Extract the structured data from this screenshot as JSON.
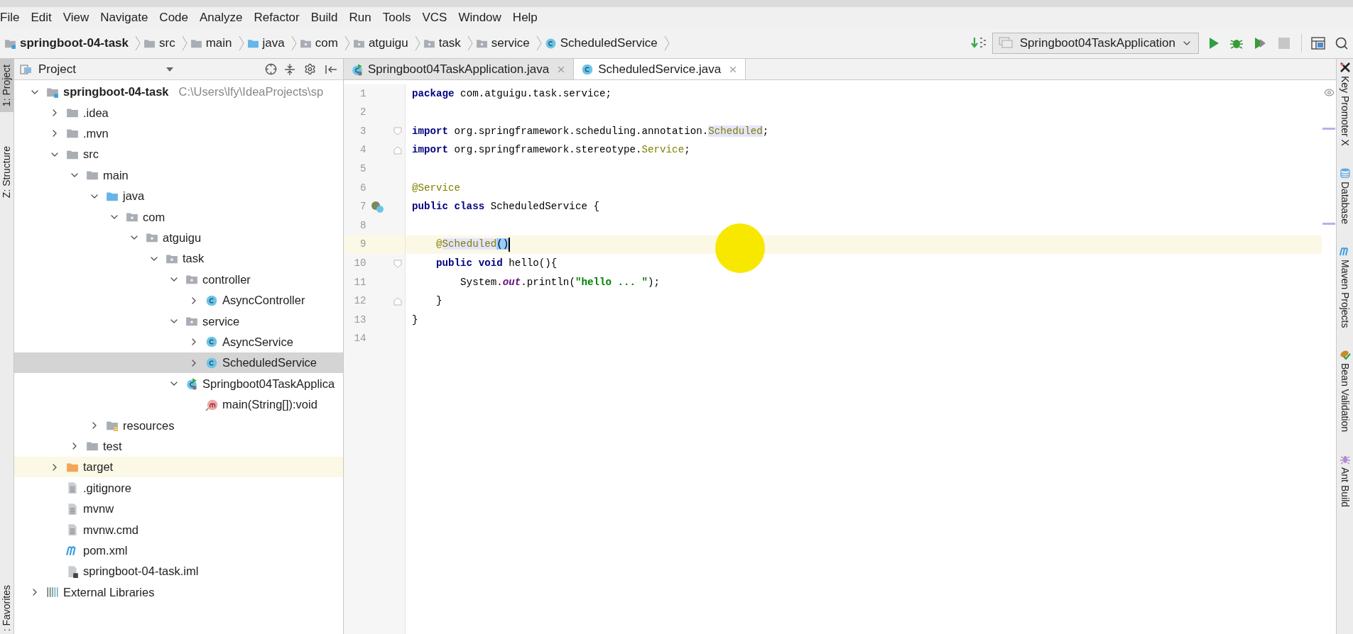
{
  "menu": [
    "File",
    "Edit",
    "View",
    "Navigate",
    "Code",
    "Analyze",
    "Refactor",
    "Build",
    "Run",
    "Tools",
    "VCS",
    "Window",
    "Help"
  ],
  "breadcrumb": [
    {
      "kind": "module",
      "text": "springboot-04-task"
    },
    {
      "kind": "folder",
      "text": "src"
    },
    {
      "kind": "folder",
      "text": "main"
    },
    {
      "kind": "source-folder",
      "text": "java"
    },
    {
      "kind": "package",
      "text": "com"
    },
    {
      "kind": "package",
      "text": "atguigu"
    },
    {
      "kind": "package",
      "text": "task"
    },
    {
      "kind": "package",
      "text": "service"
    },
    {
      "kind": "class",
      "text": "ScheduledService"
    }
  ],
  "run_config": "Springboot04TaskApplication",
  "left_strip": {
    "top": [
      {
        "label": "1: Project",
        "selected": true
      },
      {
        "label": "Z: Structure",
        "selected": false
      }
    ],
    "bottom": [
      {
        "label": ": Favorites",
        "selected": false
      }
    ]
  },
  "project_panel": {
    "title": "Project",
    "tree": [
      {
        "kind": "module",
        "label": "springboot-04-task",
        "path": "C:\\Users\\lfy\\IdeaProjects\\sp",
        "expanded": true,
        "selected": false,
        "children": [
          {
            "kind": "folder",
            "label": ".idea",
            "expanded": false,
            "selected": false
          },
          {
            "kind": "folder",
            "label": ".mvn",
            "expanded": false,
            "selected": false
          },
          {
            "kind": "folder",
            "label": "src",
            "expanded": true,
            "selected": false,
            "children": [
              {
                "kind": "folder",
                "label": "main",
                "expanded": true,
                "selected": false,
                "children": [
                  {
                    "kind": "source-folder",
                    "label": "java",
                    "expanded": true,
                    "selected": false,
                    "children": [
                      {
                        "kind": "package",
                        "label": "com",
                        "expanded": true,
                        "selected": false,
                        "children": [
                          {
                            "kind": "package",
                            "label": "atguigu",
                            "expanded": true,
                            "selected": false,
                            "children": [
                              {
                                "kind": "package",
                                "label": "task",
                                "expanded": true,
                                "selected": false,
                                "children": [
                                  {
                                    "kind": "package",
                                    "label": "controller",
                                    "expanded": true,
                                    "selected": false,
                                    "children": [
                                      {
                                        "kind": "class",
                                        "label": "AsyncController",
                                        "expanded": false,
                                        "selected": false
                                      }
                                    ]
                                  },
                                  {
                                    "kind": "package",
                                    "label": "service",
                                    "expanded": true,
                                    "selected": false,
                                    "children": [
                                      {
                                        "kind": "class",
                                        "label": "AsyncService",
                                        "expanded": false,
                                        "selected": false
                                      },
                                      {
                                        "kind": "class",
                                        "label": "ScheduledService",
                                        "expanded": false,
                                        "selected": true
                                      }
                                    ]
                                  },
                                  {
                                    "kind": "app",
                                    "label": "Springboot04TaskApplica",
                                    "expanded": true,
                                    "selected": false,
                                    "children": [
                                      {
                                        "kind": "method",
                                        "label": "main(String[]):void",
                                        "selected": false
                                      }
                                    ]
                                  }
                                ]
                              }
                            ]
                          }
                        ]
                      }
                    ]
                  },
                  {
                    "kind": "resources",
                    "label": "resources",
                    "expanded": false,
                    "selected": false
                  }
                ]
              },
              {
                "kind": "folder",
                "label": "test",
                "expanded": false,
                "selected": false
              }
            ]
          },
          {
            "kind": "excluded",
            "label": "target",
            "expanded": false,
            "selected": false
          },
          {
            "kind": "file",
            "label": ".gitignore",
            "selected": false
          },
          {
            "kind": "file",
            "label": "mvnw",
            "selected": false
          },
          {
            "kind": "file",
            "label": "mvnw.cmd",
            "selected": false
          },
          {
            "kind": "maven",
            "label": "pom.xml",
            "selected": false
          },
          {
            "kind": "iml",
            "label": "springboot-04-task.iml",
            "selected": false
          }
        ]
      },
      {
        "kind": "libraries",
        "label": "External Libraries",
        "expanded": false,
        "selected": false
      }
    ]
  },
  "tabs": [
    {
      "kind": "app",
      "label": "Springboot04TaskApplication.java",
      "selected": false
    },
    {
      "kind": "class",
      "label": "ScheduledService.java",
      "selected": true
    }
  ],
  "editor": {
    "lines": [
      {
        "num": "1",
        "kind": "plain",
        "current": false,
        "tokens": [
          {
            "kind": "keyword",
            "text": "package"
          },
          {
            "kind": "text",
            "text": " com.atguigu.task.service;"
          }
        ]
      },
      {
        "num": "2",
        "kind": "plain",
        "current": false
      },
      {
        "num": "3",
        "kind": "fold-start",
        "current": false,
        "tokens": [
          {
            "kind": "keyword",
            "text": "import"
          },
          {
            "kind": "text",
            "text": " org.springframework.scheduling.annotation."
          },
          {
            "kind": "usage",
            "text": "Scheduled"
          },
          {
            "kind": "text",
            "text": ";"
          }
        ]
      },
      {
        "num": "4",
        "kind": "fold-end",
        "current": false,
        "tokens": [
          {
            "kind": "keyword",
            "text": "import"
          },
          {
            "kind": "text",
            "text": " org.springframework.stereotype."
          },
          {
            "kind": "annotation",
            "text": "Service"
          },
          {
            "kind": "text",
            "text": ";"
          }
        ]
      },
      {
        "num": "5",
        "kind": "plain",
        "current": false
      },
      {
        "num": "6",
        "kind": "plain",
        "current": false,
        "tokens": [
          {
            "kind": "annotation",
            "text": "@Service"
          }
        ]
      },
      {
        "num": "7",
        "kind": "class-marker",
        "current": false,
        "tokens": [
          {
            "kind": "keyword",
            "text": "public class"
          },
          {
            "kind": "text",
            "text": " ScheduledService {"
          }
        ]
      },
      {
        "num": "8",
        "kind": "plain",
        "current": false
      },
      {
        "num": "9",
        "kind": "plain",
        "current": true,
        "tokens": [
          {
            "kind": "annotation",
            "text": "    @"
          },
          {
            "kind": "usage",
            "text": "Scheduled"
          },
          {
            "kind": "brace",
            "text": "()"
          }
        ]
      },
      {
        "num": "10",
        "kind": "fold-start",
        "current": false,
        "tokens": [
          {
            "kind": "keyword",
            "text": "    public void"
          },
          {
            "kind": "text",
            "text": " hello(){"
          }
        ]
      },
      {
        "num": "11",
        "kind": "plain",
        "current": false,
        "tokens": [
          {
            "kind": "text",
            "text": "        System."
          },
          {
            "kind": "static",
            "text": "out"
          },
          {
            "kind": "text",
            "text": ".println("
          },
          {
            "kind": "string",
            "text": "\"hello ... \""
          },
          {
            "kind": "text",
            "text": ");"
          }
        ]
      },
      {
        "num": "12",
        "kind": "fold-end",
        "current": false,
        "tokens": [
          {
            "kind": "text",
            "text": "    }"
          }
        ]
      },
      {
        "num": "13",
        "kind": "plain",
        "current": false,
        "tokens": [
          {
            "kind": "text",
            "text": "}"
          }
        ]
      },
      {
        "num": "14",
        "kind": "plain",
        "current": false
      }
    ]
  },
  "right_strip": [
    {
      "kind": "key-promoter",
      "label": "Key Promoter X"
    },
    {
      "kind": "database",
      "label": "Database"
    },
    {
      "kind": "maven",
      "label": "Maven Projects"
    },
    {
      "kind": "bean",
      "label": "Bean Validation"
    },
    {
      "kind": "ant",
      "label": "Ant Build"
    }
  ]
}
